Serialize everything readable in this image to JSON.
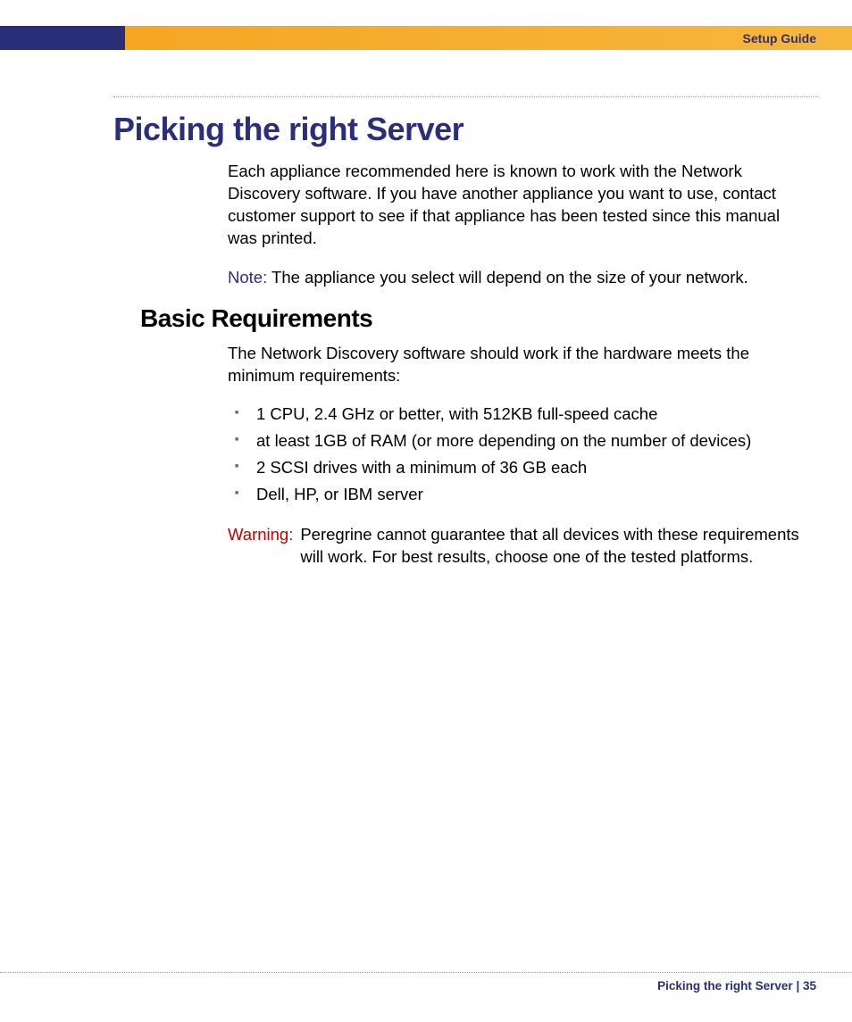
{
  "header": {
    "guide_label": "Setup Guide"
  },
  "title": "Picking the right Server",
  "intro": "Each appliance recommended here is known to work with the Network Discovery software. If you have another appliance you want to use, contact customer support to see if that appliance has been tested since this manual was printed.",
  "note": {
    "label": "Note:",
    "text": "The appliance you select will depend on the size of your network."
  },
  "section": {
    "heading": "Basic Requirements",
    "intro": "The Network Discovery software should work if the hardware meets the minimum requirements:",
    "items": [
      "1 CPU, 2.4 GHz or better, with 512KB full-speed cache",
      "at least 1GB of RAM (or more depending on the number of devices)",
      "2 SCSI drives with a minimum of 36 GB each",
      "Dell, HP, or IBM server"
    ]
  },
  "warning": {
    "label": "Warning:",
    "text": "Peregrine cannot guarantee that all devices with these requirements will work. For best results, choose one of the tested platforms."
  },
  "footer": {
    "section": "Picking the right Server",
    "separator": " | ",
    "page": "35"
  }
}
